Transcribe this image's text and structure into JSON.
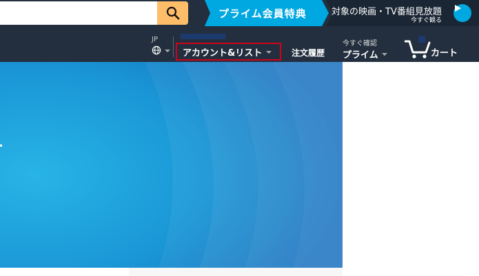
{
  "header": {
    "search": {
      "value": "",
      "placeholder": ""
    },
    "search_icon": "search-icon",
    "prime_banner": {
      "perks_label": "プライム会員特典",
      "video_line1": "対象の映画・TV番組見放題",
      "video_line2": "今すぐ観る",
      "play_icon": "play-icon"
    }
  },
  "nav": {
    "lang_label": "JP",
    "lang_icon": "globe-icon",
    "account_label": "アカウント&リスト",
    "orders_label": "注文履歴",
    "prime_top": "今すぐ確認",
    "prime_bottom": "プライム",
    "cart_label": "カート",
    "cart_icon": "cart-icon"
  },
  "colors": {
    "nav_bg": "#232f3e",
    "search_button": "#febd69",
    "prime_blue": "#00a8e1",
    "highlight_border": "#d0021b",
    "hero_blue": "#1f8fd3"
  }
}
